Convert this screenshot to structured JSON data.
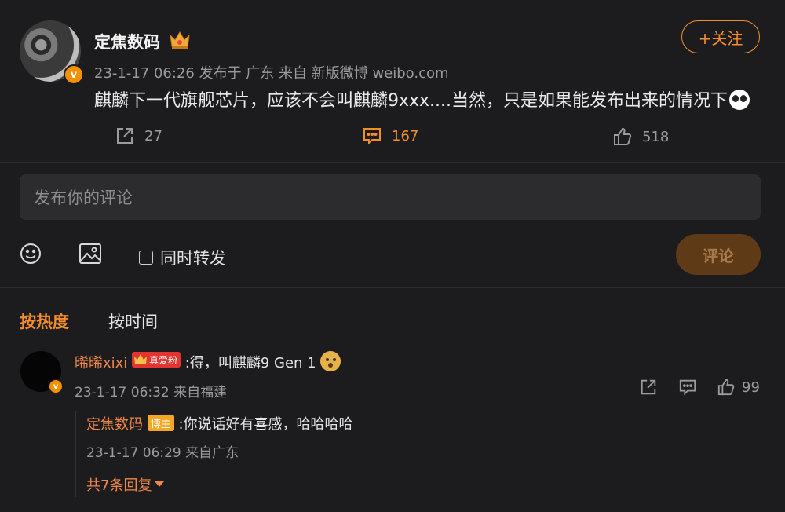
{
  "post": {
    "author": "定焦数码",
    "meta": "23-1-17 06:26  发布于 广东  来自 新版微博 weibo.com",
    "content": "麒麟下一代旗舰芯片，应该不会叫麒麟9xxx....当然，只是如果能发布出来的情况下",
    "follow_label": "+关注",
    "verified_label": "v",
    "actions": {
      "repost_count": "27",
      "comment_count": "167",
      "like_count": "518"
    }
  },
  "comment_input": {
    "placeholder": "发布你的评论",
    "repost_label": "同时转发",
    "submit_label": "评论"
  },
  "sort_tabs": {
    "hot": "按热度",
    "time": "按时间"
  },
  "comments": [
    {
      "author": "晞晞xixi",
      "badge": "真爱粉",
      "text": ":得，叫麒麟9 Gen 1",
      "meta": "23-1-17 06:32 来自福建",
      "like_count": "99",
      "reply": {
        "author": "定焦数码",
        "badge": "博主",
        "text": ":你说话好有喜感，哈哈哈哈",
        "meta": "23-1-17 06:29 来自广东"
      },
      "more_replies": "共7条回复"
    }
  ],
  "colors": {
    "background": "#1c1c1e",
    "accent": "#f58e2a",
    "name": "#f0874a"
  },
  "icons": [
    "repost-icon",
    "comment-icon",
    "like-icon",
    "emoji-icon",
    "image-icon",
    "crown-icon",
    "caret-down-icon"
  ]
}
